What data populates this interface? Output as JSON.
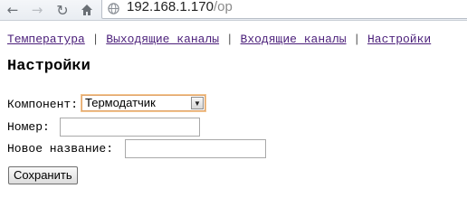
{
  "browser": {
    "url_host": "192.168.1.170",
    "url_path": "/op"
  },
  "nav": {
    "items": [
      {
        "label": "Температура"
      },
      {
        "label": "Выходящие каналы"
      },
      {
        "label": "Входящие каналы"
      },
      {
        "label": "Настройки"
      }
    ],
    "separator": "|"
  },
  "page": {
    "title": "Настройки"
  },
  "form": {
    "component_label": "Компонент:",
    "component_value": "Термодатчик",
    "number_label": "Номер:",
    "number_value": "",
    "name_label": "Новое название:",
    "name_value": "",
    "save_label": "Сохранить"
  }
}
